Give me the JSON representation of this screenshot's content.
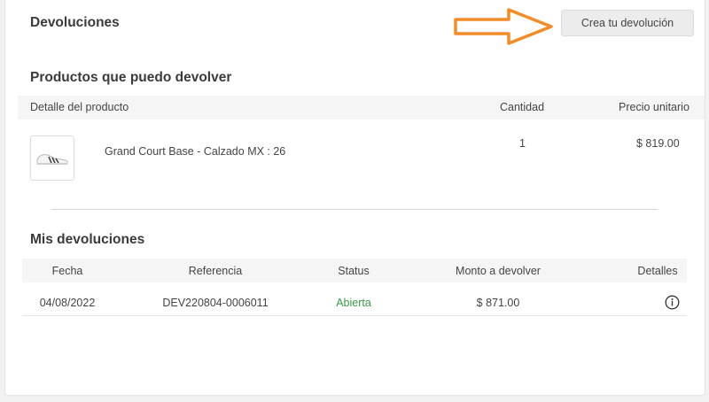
{
  "header": {
    "title": "Devoluciones",
    "create_button_label": "Crea tu devolución",
    "arrow_color": "#f28c28"
  },
  "products": {
    "section_title": "Productos que puedo devolver",
    "columns": {
      "detail": "Detalle del producto",
      "quantity": "Cantidad",
      "unit_price": "Precio unitario"
    },
    "items": [
      {
        "name": "Grand Court Base - Calzado MX : 26",
        "quantity": "1",
        "unit_price": "$ 819.00",
        "thumbnail_icon": "sneaker-icon"
      }
    ]
  },
  "returns": {
    "section_title": "Mis devoluciones",
    "columns": {
      "date": "Fecha",
      "reference": "Referencia",
      "status": "Status",
      "amount": "Monto a devolver",
      "details": "Detalles"
    },
    "rows": [
      {
        "date": "04/08/2022",
        "reference": "DEV220804-0006011",
        "status": "Abierta",
        "amount": "$ 871.00",
        "details_icon": "info-icon"
      }
    ]
  },
  "colors": {
    "status_open": "#3a9a4a",
    "header_bg": "#f5f5f5"
  }
}
